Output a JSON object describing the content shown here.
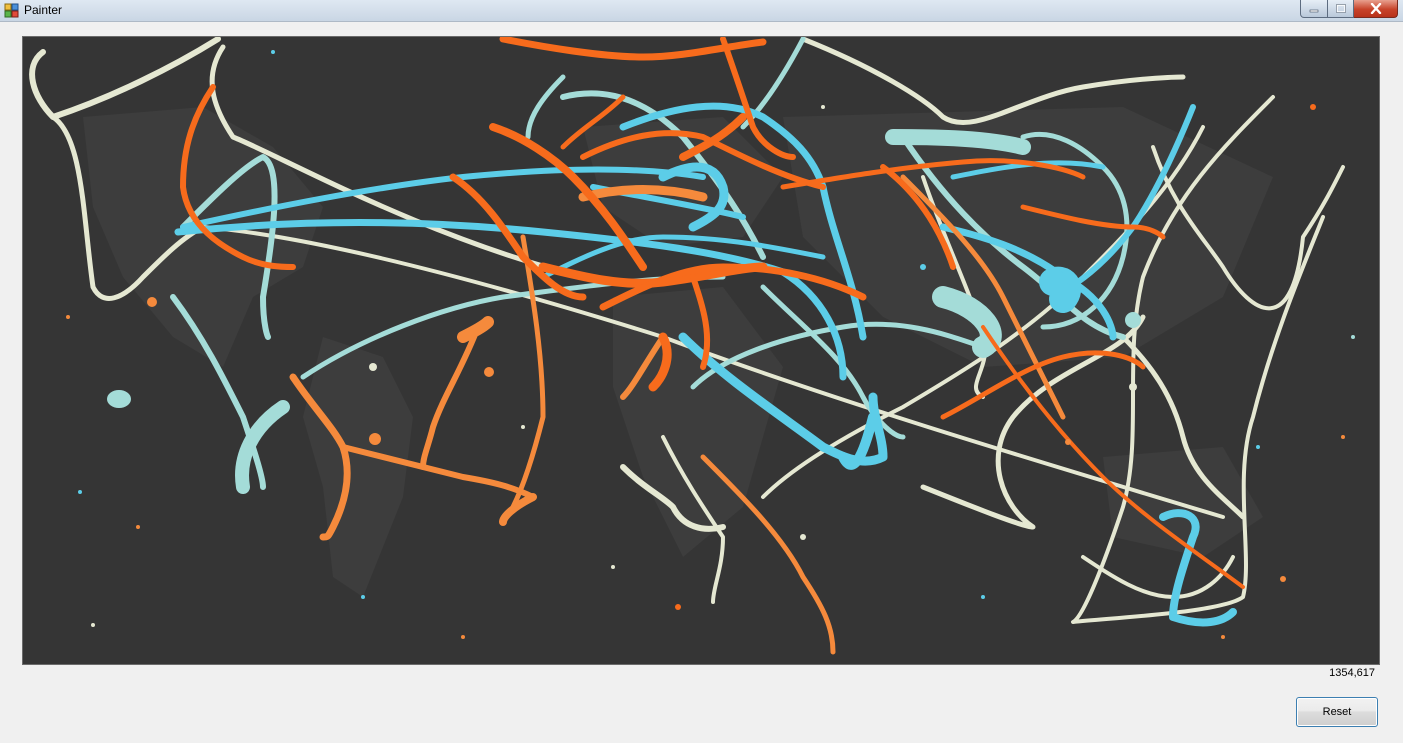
{
  "window": {
    "title": "Painter",
    "app_icon": "painter-app-icon",
    "controls": {
      "minimize": "minimize-icon",
      "maximize": "maximize-icon",
      "close": "close-icon"
    }
  },
  "canvas": {
    "background_color": "#353535",
    "paint_colors": {
      "orange": "#f76b1c",
      "orange_light": "#f58a3c",
      "cyan": "#5ccde8",
      "pale_teal": "#a4dcd8",
      "cream": "#e5e8d2"
    }
  },
  "status": {
    "coordinates": "1354,617"
  },
  "buttons": {
    "reset_label": "Reset"
  }
}
